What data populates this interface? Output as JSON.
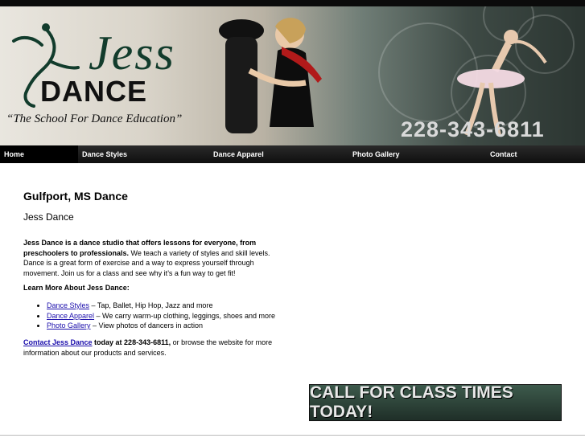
{
  "banner": {
    "logo_top": "Jess",
    "logo_bottom": "DANCE",
    "tagline": "“The School For Dance Education”",
    "phone": "228-343-6811"
  },
  "nav": {
    "items": [
      {
        "label": "Home"
      },
      {
        "label": "Dance Styles"
      },
      {
        "label": "Dance Apparel"
      },
      {
        "label": "Photo Gallery"
      },
      {
        "label": "Contact"
      }
    ]
  },
  "main": {
    "heading": "Gulfport, MS Dance",
    "subheading": "Jess Dance",
    "intro_bold": "Jess Dance is a dance studio that offers lessons for everyone, from preschoolers to professionals.",
    "intro_rest": " We teach a variety of styles and skill levels. Dance is a great form of exercise and a way to express yourself through movement. Join us for a class and see why it’s a fun way to get fit!",
    "learn_more": "Learn More About Jess Dance:",
    "list": [
      {
        "link": "Dance Styles",
        "text": " – Tap, Ballet, Hip Hop, Jazz and more"
      },
      {
        "link": "Dance Apparel",
        "text": " – We carry warm-up clothing, leggings, shoes and more"
      },
      {
        "link": "Photo Gallery",
        "text": " – View photos of dancers in action"
      }
    ],
    "contact_link": "Contact Jess Dance",
    "contact_bold": " today at 228-343-6811,",
    "contact_rest": " or browse the website for more information about our products and services."
  },
  "promo": {
    "text": "CALL FOR CLASS TIMES TODAY!"
  }
}
